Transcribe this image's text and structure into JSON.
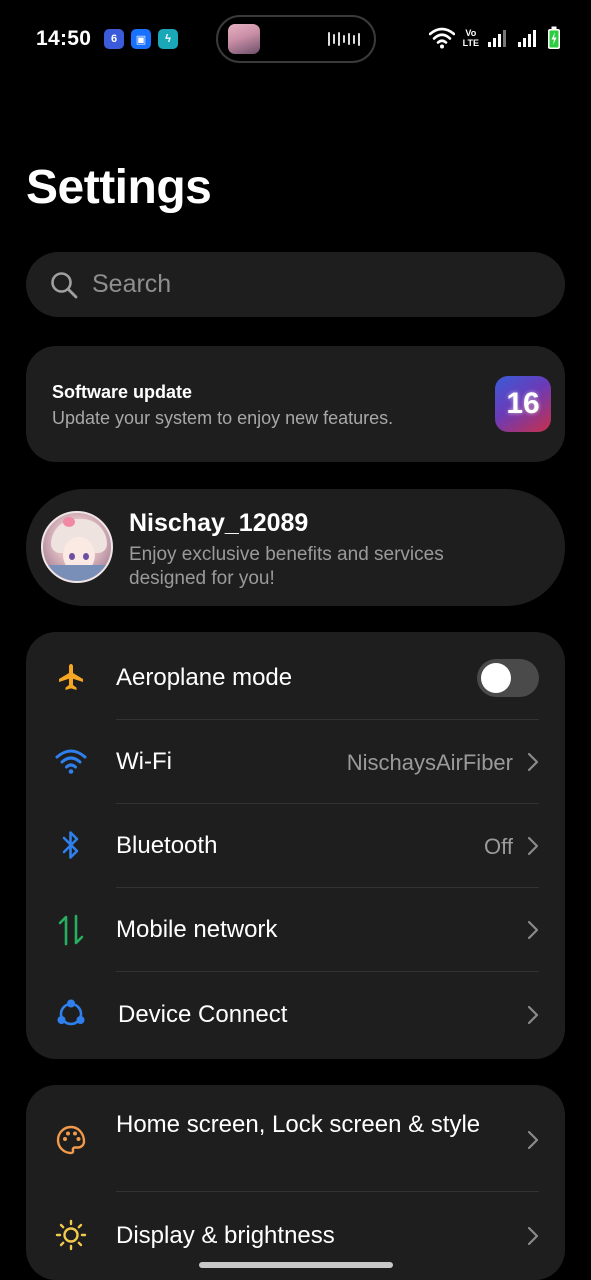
{
  "status_bar": {
    "time": "14:50",
    "volte_line1": "Vo",
    "volte_line2": "LTE",
    "notification_icons": [
      {
        "name": "app-6-icon",
        "glyph": "6",
        "color": "#3b5bdb"
      },
      {
        "name": "app-window-icon",
        "glyph": "▣",
        "color": "#1971ff"
      },
      {
        "name": "app-bolt-icon",
        "glyph": "ϟ",
        "color": "#1aa8b8"
      }
    ]
  },
  "page": {
    "title": "Settings"
  },
  "search": {
    "placeholder": "Search"
  },
  "software_update": {
    "title": "Software update",
    "subtitle": "Update your system to enjoy new features.",
    "badge": "16"
  },
  "profile": {
    "name": "Nischay_12089",
    "subtitle": "Enjoy exclusive benefits and services designed for you!"
  },
  "connectivity": [
    {
      "label": "Aeroplane mode",
      "value": "",
      "icon": "airplane-icon",
      "icon_color": "#f5a623",
      "toggle_on": false
    },
    {
      "label": "Wi-Fi",
      "value": "NischaysAirFiber",
      "icon": "wifi-icon",
      "icon_color": "#2f80ed"
    },
    {
      "label": "Bluetooth",
      "value": "Off",
      "icon": "bluetooth-icon",
      "icon_color": "#2f80ed"
    },
    {
      "label": "Mobile network",
      "value": "",
      "icon": "mobile-data-icon",
      "icon_color": "#27ae60"
    },
    {
      "label": "Device Connect",
      "value": "",
      "icon": "device-connect-icon",
      "icon_color": "#2f80ed"
    }
  ],
  "personalization": [
    {
      "label": "Home screen, Lock screen & style",
      "icon": "palette-icon",
      "icon_color": "#f2994a"
    },
    {
      "label": "Display & brightness",
      "icon": "sun-icon",
      "icon_color": "#f2c94c"
    }
  ]
}
